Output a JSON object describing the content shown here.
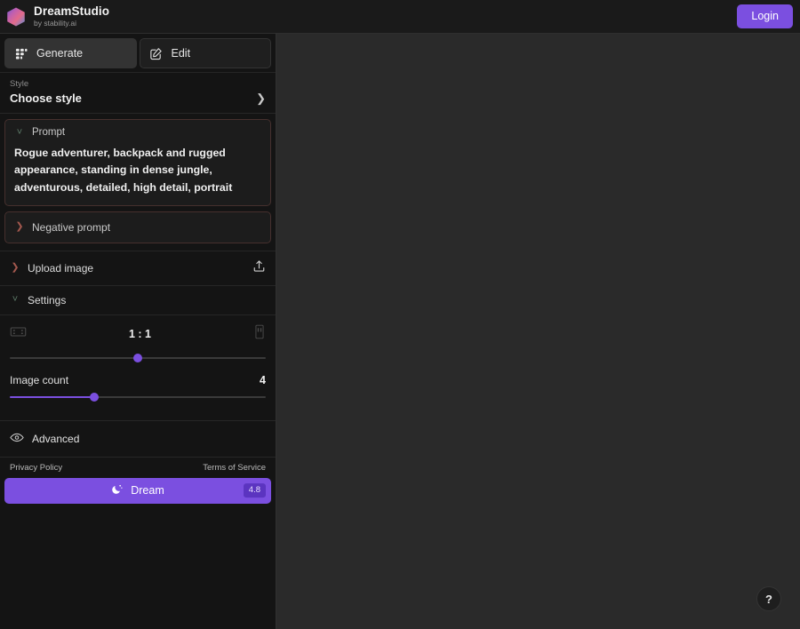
{
  "app": {
    "brand_name": "DreamStudio",
    "brand_subtitle": "by stability.ai",
    "logo_icon": "hexagon-gradient-logo",
    "login_label": "Login",
    "accent_color": "#7b4fe0",
    "badge_color": "#5b34c0",
    "sidebar_bg": "#141414",
    "canvas_bg": "#2a2a2a"
  },
  "tabs": [
    {
      "label": "Generate",
      "icon": "grid-dots-icon",
      "active": true
    },
    {
      "label": "Edit",
      "icon": "pencil-square-icon",
      "active": false
    }
  ],
  "style": {
    "label": "Style",
    "value": "Choose style",
    "chevron_icon": "chevron-right-icon"
  },
  "prompt": {
    "title": "Prompt",
    "caret_icon": "chevron-down-icon",
    "text": "Rogue adventurer, backpack and rugged appearance, standing in dense jungle, adventurous, detailed, high detail, portrait"
  },
  "negative_prompt": {
    "title": "Negative prompt",
    "caret_icon": "chevron-right-icon"
  },
  "upload": {
    "title": "Upload image",
    "caret_icon": "chevron-right-icon",
    "action_icon": "upload-icon"
  },
  "settings": {
    "title": "Settings",
    "caret_icon": "chevron-down-icon",
    "aspect_ratio": {
      "value": "1 : 1",
      "left_icon": "landscape-rect-icon",
      "right_icon": "portrait-rect-icon",
      "slider_percent": 50
    },
    "image_count": {
      "label": "Image count",
      "value": "4",
      "slider_percent": 33
    }
  },
  "advanced": {
    "title": "Advanced",
    "icon": "eye-icon"
  },
  "footer": {
    "privacy_label": "Privacy Policy",
    "terms_label": "Terms of Service",
    "dream_label": "Dream",
    "dream_icon": "moon-sparkle-icon",
    "credit_cost": "4.8"
  },
  "help": {
    "label": "?",
    "icon": "question-mark-icon"
  }
}
